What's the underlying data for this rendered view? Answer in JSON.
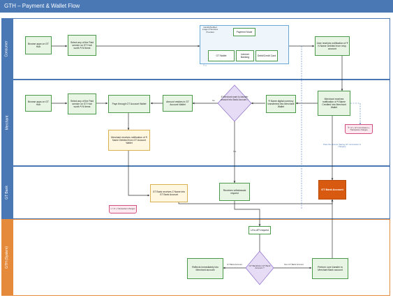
{
  "title": "GTH – Payment & Wallet Flow",
  "lanes": {
    "consumer": "Consumer",
    "merchant": "Merchant",
    "gt_bank": "GT Bank",
    "gth_system": "GTH (System)"
  },
  "consumer": {
    "browse": "Browse apps on GT Hub",
    "select": "Select any of the Paid service on GT Hub worth ₹ N Items",
    "payment_mode": "Payment Mode",
    "gt_wallet": "GT Wallet",
    "internet_banking": "Internet Banking",
    "debit_credit": "Debit/Credit Card",
    "group_note": "Identify/Notified image of Services Provided",
    "user_receives": "User receives notification of ₹ N Name Debited from resp. account"
  },
  "merchant": {
    "browse": "Browse apps on GT Hub",
    "select": "Select any of the Paid service on GT Hub worth ₹ N Items",
    "pays": "Pays through GT Account Wallet",
    "amount_resides": "Amount resides in GT Account Wallet",
    "decision": "If Merchant want to transfer amount into Bank Account ?",
    "digital_currency": "₹ Name digital currency transferred into Merchant Wallet",
    "merchant_receives": "Merchant receives notification of ₹ Name Credited into Merchant Wallet",
    "merchant_notif2": "Merchant receives notification of ₹ Name Debited from GT Account Wallet",
    "pink_note": "₹ = Z + GT commission + Transaction charges",
    "no_label": "No",
    "yes_label": "Yes",
    "pending_note": "Pass the amount (having GT commission & charges)"
  },
  "gt_bank": {
    "receives": "GT Bank receives Z Name into GT Bank Account",
    "withdrawals": "Receives withdrawals request",
    "gt_bank_account": "GT Bank Account",
    "pink_note": "L = Z + Transaction charges"
  },
  "gth": {
    "ui_request": "UI to API request",
    "decision": "GT Bank/Non GT Bank Account ?",
    "gt_bank_label": "GT Bank Account",
    "non_gt_label": "Non GT Bank Account",
    "reflects": "Reflects immediately into Merchant account",
    "transfer": "Perform core transfer to Merchant Bank account"
  },
  "colors": {
    "titlebar": "#4a78b5",
    "lane_blue": "#4a78b5",
    "lane_orange": "#e58a3a",
    "box_border": "#4a9a4a",
    "box_fill": "#e8f4e4",
    "decision_fill": "#e6dcf5",
    "decision_border": "#8a6ac8",
    "bank_account": "#d85a10"
  }
}
